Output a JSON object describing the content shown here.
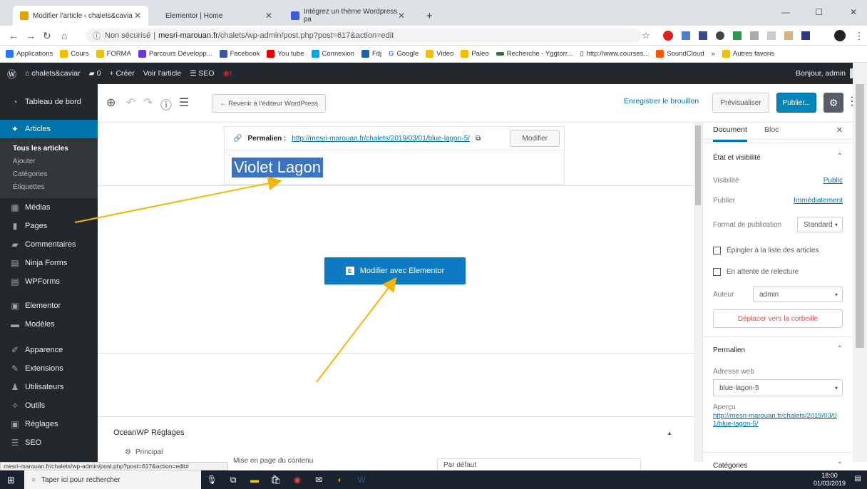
{
  "browser": {
    "tabs": [
      {
        "label": "Modifier l'article ‹ chalets&cavia",
        "active": true
      },
      {
        "label": "Elementor | Home",
        "active": false
      },
      {
        "label": "Intégrez un thème Wordpress pa",
        "active": false
      }
    ],
    "new_tab": "+",
    "url_secure": "Non sécurisé",
    "url_host": "mesri-marouan.fr",
    "url_path": "/chalets/wp-admin/post.php?post=617&action=edit",
    "bookmarks": [
      "Applications",
      "Cours",
      "FORMA",
      "Parcours Développ...",
      "Facebook",
      "You tube",
      "Connexion",
      "Fdj",
      "Google",
      "Video",
      "Paleo",
      "Recherche - Yggtorr...",
      "http://www.courses...",
      "SoundCloud",
      "»",
      "Autres favoris"
    ]
  },
  "adminbar": {
    "site": "chalets&caviar",
    "comments": "0",
    "create": "+ Créer",
    "view": "Voir l'article",
    "seo": "SEO",
    "greeting": "Bonjour, admin"
  },
  "sidebar": {
    "items": [
      {
        "label": "Tableau de bord",
        "icon": "dashboard-icon"
      },
      {
        "label": "Articles",
        "icon": "pin-icon"
      },
      {
        "label": "Médias",
        "icon": "media-icon"
      },
      {
        "label": "Pages",
        "icon": "pages-icon"
      },
      {
        "label": "Commentaires",
        "icon": "comments-icon"
      },
      {
        "label": "Ninja Forms",
        "icon": "form-icon"
      },
      {
        "label": "WPForms",
        "icon": "form-icon"
      },
      {
        "label": "Elementor",
        "icon": "elementor-icon"
      },
      {
        "label": "Modèles",
        "icon": "folder-icon"
      },
      {
        "label": "Apparence",
        "icon": "brush-icon"
      },
      {
        "label": "Extensions",
        "icon": "plugin-icon"
      },
      {
        "label": "Utilisateurs",
        "icon": "users-icon"
      },
      {
        "label": "Outils",
        "icon": "wrench-icon"
      },
      {
        "label": "Réglages",
        "icon": "settings-icon"
      },
      {
        "label": "SEO",
        "icon": "seo-icon"
      }
    ],
    "submenu": [
      "Tous les articles",
      "Ajouter",
      "Catégories",
      "Étiquettes"
    ]
  },
  "toolbar": {
    "back": "← Revenir à l'éditeur WordPress",
    "draft": "Enregistrer le brouillon",
    "preview": "Prévisualiser",
    "publish": "Publier..."
  },
  "editor": {
    "permalink_label": "Permalien :",
    "permalink_url": "http://mesri-marouan.fr/chalets/2019/03/01/blue-lagon-5/",
    "permalink_edit": "Modifier",
    "title": "Violet Lagon",
    "elementor_button": "Modifier avec Elementor",
    "ocean_title": "OceanWP Réglages",
    "ocean_principal": "Principal",
    "ocean_layout": "Mise en page du contenu",
    "ocean_default": "Par défaut"
  },
  "panel": {
    "tab_document": "Document",
    "tab_block": "Bloc",
    "status_title": "État et visibilité",
    "visibility_label": "Visibilité",
    "visibility_value": "Public",
    "publish_label": "Publier",
    "publish_value": "Immédiatement",
    "format_label": "Format de publication",
    "format_value": "Standard",
    "sticky": "Épingler à la liste des articles",
    "pending": "En attente de relecture",
    "author_label": "Auteur",
    "author_value": "admin",
    "trash": "Déplacer vers la corbeille",
    "permalink_title": "Permalien",
    "web_address": "Adresse web",
    "slug": "blue-lagon-5",
    "preview_label": "Aperçu",
    "preview_link": "http://mesri-marouan.fr/chalets/2019/03/01/blue-lagon-5/",
    "categories": "Catégories"
  },
  "status_bar": "mesri-marouan.fr/chalets/wp-admin/post.php?post=617&action=edit#",
  "taskbar": {
    "search": "Taper ici pour rechercher",
    "time": "18:00",
    "date": "01/03/2019"
  },
  "colors": {
    "wp_blue": "#0073aa",
    "admin_dark": "#23282d",
    "annotation_arrow": "#f2b705"
  }
}
